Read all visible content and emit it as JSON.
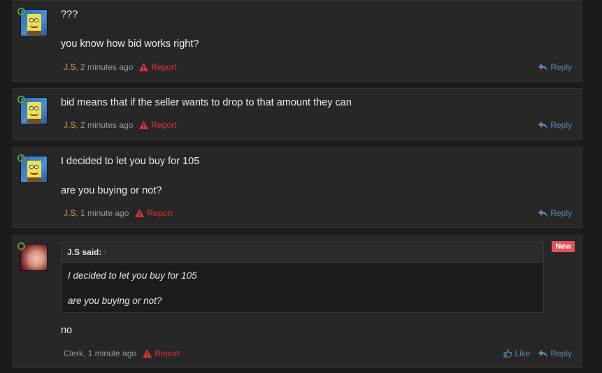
{
  "posts": [
    {
      "lines": [
        "???",
        "you know how bid works right?"
      ],
      "author": "J.S",
      "time": ", 2 minutes ago",
      "report": "Report",
      "reply": "Reply"
    },
    {
      "lines": [
        "bid means that if the seller wants to drop to that amount they can"
      ],
      "author": "J.S",
      "time": ", 2 minutes ago",
      "report": "Report",
      "reply": "Reply"
    },
    {
      "lines": [
        "I decided to let you buy for 105",
        "are you buying or not?"
      ],
      "author": "J.S",
      "time": ", 1 minute ago",
      "report": "Report",
      "reply": "Reply"
    },
    {
      "badge": "New",
      "quote": {
        "header": "J.S said:",
        "arrow": "↑",
        "lines": [
          "I decided to let you buy for 105",
          "are you buying or not?"
        ]
      },
      "lines": [
        "no"
      ],
      "author": "Clerk",
      "time": ", 1 minute ago",
      "report": "Report",
      "like": "Like",
      "reply": "Reply"
    }
  ],
  "colors": {
    "background": "#1b1b1b",
    "post_bg": "#272727",
    "author_js": "#d89a35",
    "report_red": "#e0322f",
    "link_blue": "#5b86b3",
    "badge_red": "#e25454"
  },
  "icons": {
    "report": "warning-triangle-icon",
    "reply": "reply-arrow-icon",
    "like": "thumbs-up-icon",
    "online": "online-status-ring-icon"
  }
}
